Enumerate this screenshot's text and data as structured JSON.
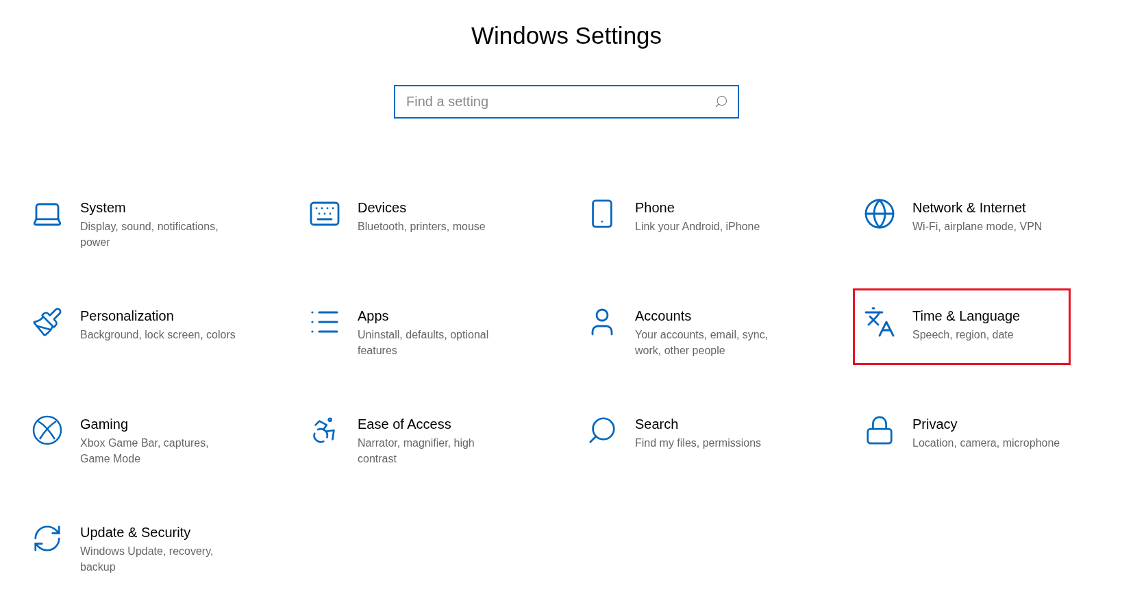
{
  "window": {
    "title": "Windows Settings"
  },
  "search": {
    "placeholder": "Find a setting"
  },
  "categories": [
    {
      "kind": "system",
      "name": "System",
      "description": "Display, sound, notifications, power",
      "highlighted": false
    },
    {
      "kind": "devices",
      "name": "Devices",
      "description": "Bluetooth, printers, mouse",
      "highlighted": false
    },
    {
      "kind": "phone",
      "name": "Phone",
      "description": "Link your Android, iPhone",
      "highlighted": false
    },
    {
      "kind": "network",
      "name": "Network & Internet",
      "description": "Wi-Fi, airplane mode, VPN",
      "highlighted": false
    },
    {
      "kind": "personalization",
      "name": "Personalization",
      "description": "Background, lock screen, colors",
      "highlighted": false
    },
    {
      "kind": "apps",
      "name": "Apps",
      "description": "Uninstall, defaults, optional features",
      "highlighted": false
    },
    {
      "kind": "accounts",
      "name": "Accounts",
      "description": "Your accounts, email, sync, work, other people",
      "highlighted": false
    },
    {
      "kind": "time",
      "name": "Time & Language",
      "description": "Speech, region, date",
      "highlighted": true
    },
    {
      "kind": "gaming",
      "name": "Gaming",
      "description": "Xbox Game Bar, captures, Game Mode",
      "highlighted": false
    },
    {
      "kind": "ease",
      "name": "Ease of Access",
      "description": "Narrator, magnifier, high contrast",
      "highlighted": false
    },
    {
      "kind": "search",
      "name": "Search",
      "description": "Find my files, permissions",
      "highlighted": false
    },
    {
      "kind": "privacy",
      "name": "Privacy",
      "description": "Location, camera, microphone",
      "highlighted": false
    },
    {
      "kind": "update",
      "name": "Update & Security",
      "description": "Windows Update, recovery, backup",
      "highlighted": false
    }
  ]
}
